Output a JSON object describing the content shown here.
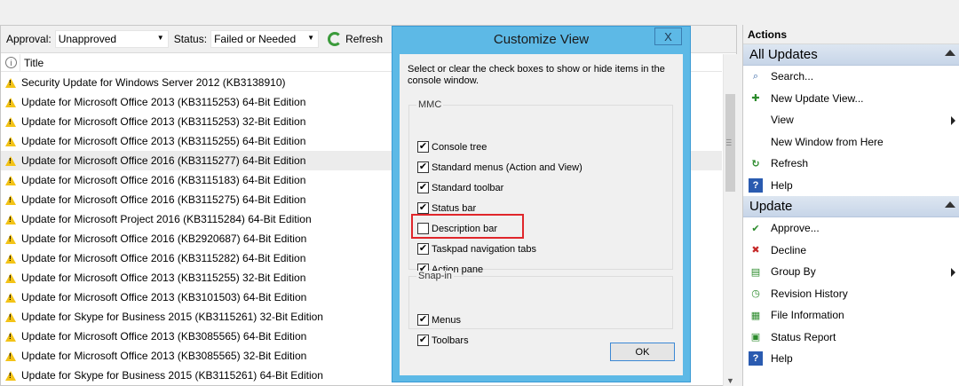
{
  "toolbar": {
    "approval_label": "Approval:",
    "approval_value": "Unapproved",
    "status_label": "Status:",
    "status_value": "Failed or Needed",
    "refresh_label": "Refresh"
  },
  "table": {
    "title_header": "Title",
    "rows": [
      "Security Update for Windows Server 2012 (KB3138910)",
      "Update for Microsoft Office 2013 (KB3115253) 64-Bit Edition",
      "Update for Microsoft Office 2013 (KB3115253) 32-Bit Edition",
      "Update for Microsoft Office 2013 (KB3115255) 64-Bit Edition",
      "Update for Microsoft Office 2016 (KB3115277) 64-Bit Edition",
      "Update for Microsoft Office 2016 (KB3115183) 64-Bit Edition",
      "Update for Microsoft Office 2016 (KB3115275) 64-Bit Edition",
      "Update for Microsoft Project 2016 (KB3115284) 64-Bit Edition",
      "Update for Microsoft Office 2016 (KB2920687) 64-Bit Edition",
      "Update for Microsoft Office 2016 (KB3115282) 64-Bit Edition",
      "Update for Microsoft Office 2013 (KB3115255) 32-Bit Edition",
      "Update for Microsoft Office 2013 (KB3101503) 64-Bit Edition",
      "Update for Skype for Business 2015 (KB3115261) 32-Bit Edition",
      "Update for Microsoft Office 2013 (KB3085565) 64-Bit Edition",
      "Update for Microsoft Office 2013 (KB3085565) 32-Bit Edition",
      "Update for Skype for Business 2015 (KB3115261) 64-Bit Edition"
    ]
  },
  "dialog": {
    "title": "Customize View",
    "close": "X",
    "description": "Select or clear the check boxes to show or hide items in the console window.",
    "mmc_group": "MMC",
    "mmc_items": [
      {
        "label": "Console tree",
        "checked": true
      },
      {
        "label": "Standard menus (Action and View)",
        "checked": true
      },
      {
        "label": "Standard toolbar",
        "checked": true
      },
      {
        "label": "Status bar",
        "checked": true
      },
      {
        "label": "Description bar",
        "checked": false
      },
      {
        "label": "Taskpad navigation tabs",
        "checked": true
      },
      {
        "label": "Action pane",
        "checked": true
      }
    ],
    "snapin_group": "Snap-in",
    "snapin_items": [
      {
        "label": "Menus",
        "checked": true
      },
      {
        "label": "Toolbars",
        "checked": true
      }
    ],
    "ok_label": "OK"
  },
  "actions": {
    "header": "Actions",
    "all_updates": {
      "title": "All Updates",
      "items": [
        {
          "label": "Search...",
          "icon": "search-icon"
        },
        {
          "label": "New Update View...",
          "icon": "new-view-icon"
        },
        {
          "label": "View",
          "icon": "none",
          "submenu": true
        },
        {
          "label": "New Window from Here",
          "icon": "none"
        },
        {
          "label": "Refresh",
          "icon": "refresh-icon"
        },
        {
          "label": "Help",
          "icon": "help-icon"
        }
      ]
    },
    "update": {
      "title": "Update",
      "items": [
        {
          "label": "Approve...",
          "icon": "approve-icon"
        },
        {
          "label": "Decline",
          "icon": "decline-icon"
        },
        {
          "label": "Group By",
          "icon": "group-icon",
          "submenu": true
        },
        {
          "label": "Revision History",
          "icon": "history-icon"
        },
        {
          "label": "File Information",
          "icon": "file-info-icon"
        },
        {
          "label": "Status Report",
          "icon": "report-icon"
        },
        {
          "label": "Help",
          "icon": "help-icon"
        }
      ]
    }
  },
  "colors": {
    "dialog_frame": "#5db9e6",
    "highlight": "#e0262b",
    "warning": "#f3c316"
  }
}
